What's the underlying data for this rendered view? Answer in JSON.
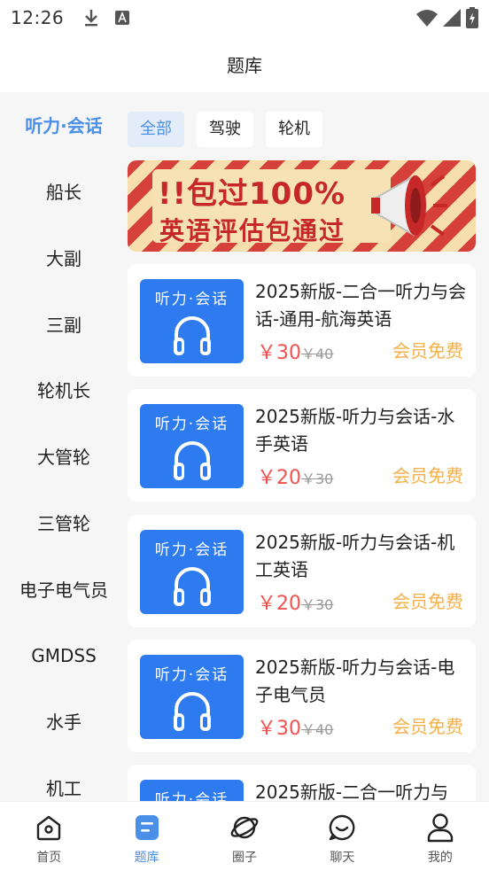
{
  "status_bar": {
    "time": "12:26",
    "icons": [
      "download-icon",
      "font-a-icon",
      "wifi-icon",
      "signal-icon",
      "battery-icon"
    ]
  },
  "header": {
    "title": "题库"
  },
  "sidebar": {
    "items": [
      {
        "label": "听力·会话",
        "active": true
      },
      {
        "label": "船长"
      },
      {
        "label": "大副"
      },
      {
        "label": "三副"
      },
      {
        "label": "轮机长"
      },
      {
        "label": "大管轮"
      },
      {
        "label": "三管轮"
      },
      {
        "label": "电子电气员"
      },
      {
        "label": "GMDSS"
      },
      {
        "label": "水手"
      },
      {
        "label": "机工"
      }
    ]
  },
  "filters": [
    {
      "label": "全部",
      "active": true
    },
    {
      "label": "驾驶"
    },
    {
      "label": "轮机"
    }
  ],
  "banner": {
    "line1": "!!包过100%",
    "line2": "英语评估包通过"
  },
  "products": [
    {
      "thumb_label": "听力·会话",
      "name": "2025新版-二合一听力与会话-通用-航海英语",
      "price": "￥30",
      "old_price": "￥40",
      "badge": "会员免费"
    },
    {
      "thumb_label": "听力·会话",
      "name": "2025新版-听力与会话-水手英语",
      "price": "￥20",
      "old_price": "￥30",
      "badge": "会员免费"
    },
    {
      "thumb_label": "听力·会话",
      "name": "2025新版-听力与会话-机工英语",
      "price": "￥20",
      "old_price": "￥30",
      "badge": "会员免费"
    },
    {
      "thumb_label": "听力·会话",
      "name": "2025新版-听力与会话-电子电气员",
      "price": "￥30",
      "old_price": "￥40",
      "badge": "会员免费"
    },
    {
      "thumb_label": "听力·会话",
      "name": "2025新版-二合一听力与",
      "price": "",
      "old_price": "",
      "badge": ""
    }
  ],
  "bottom_nav": [
    {
      "label": "首页",
      "icon": "home-icon"
    },
    {
      "label": "题库",
      "icon": "question-bank-icon",
      "active": true
    },
    {
      "label": "圈子",
      "icon": "planet-icon"
    },
    {
      "label": "聊天",
      "icon": "chat-icon"
    },
    {
      "label": "我的",
      "icon": "profile-icon"
    }
  ],
  "colors": {
    "accent": "#4a90e8",
    "price": "#ef5350",
    "member_badge": "#f5b04a",
    "thumb_bg": "#2e7bf0",
    "banner_red": "#c62828"
  }
}
